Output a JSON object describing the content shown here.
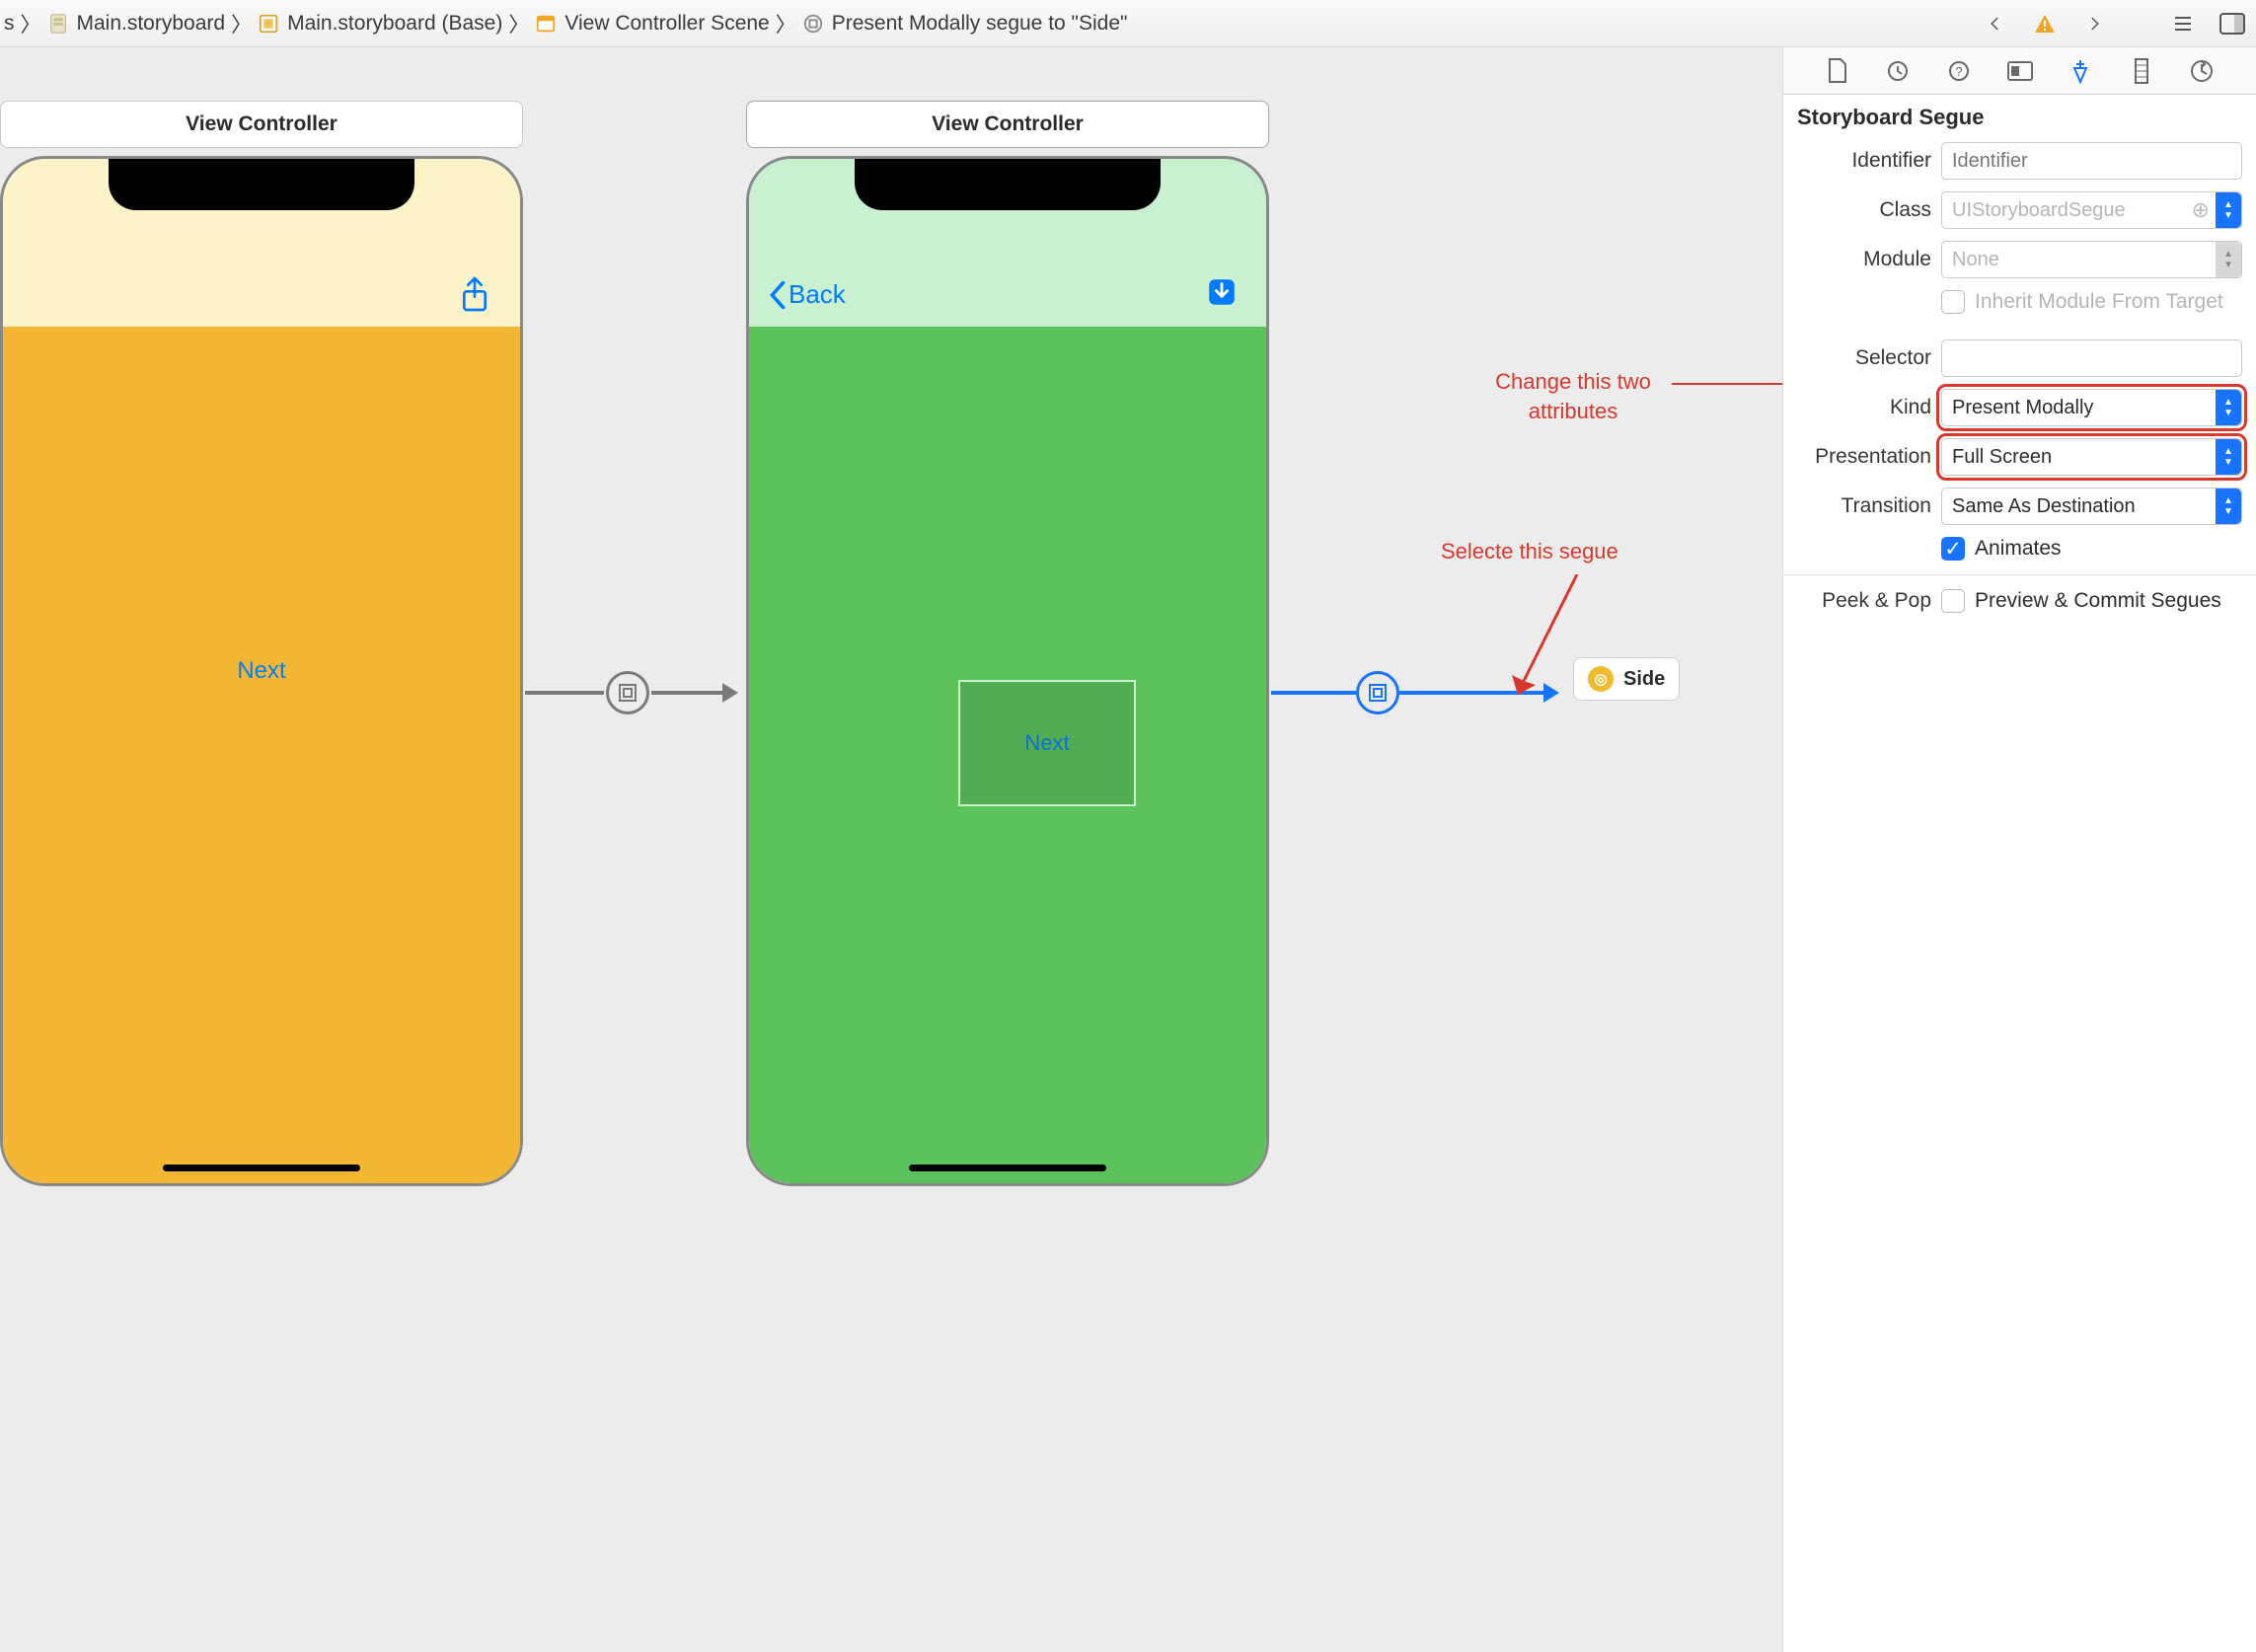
{
  "breadcrumbs": {
    "root_suffix": "s",
    "items": [
      {
        "label": "Main.storyboard"
      },
      {
        "label": "Main.storyboard (Base)"
      },
      {
        "label": "View Controller Scene"
      },
      {
        "label": "Present Modally segue to \"Side\""
      }
    ]
  },
  "canvas": {
    "scene1_title": "View Controller",
    "scene2_title": "View Controller",
    "scene1_button": "Next",
    "scene2_back": "Back",
    "scene2_container_label": "Next",
    "side_chip": "Side"
  },
  "annotations": {
    "change_attrs": "Change this two attributes",
    "select_segue": "Selecte this segue"
  },
  "inspector": {
    "section": "Storyboard Segue",
    "identifier_label": "Identifier",
    "identifier_placeholder": "Identifier",
    "class_label": "Class",
    "class_value": "UIStoryboardSegue",
    "module_label": "Module",
    "module_value": "None",
    "inherit_label": "Inherit Module From Target",
    "selector_label": "Selector",
    "kind_label": "Kind",
    "kind_value": "Present Modally",
    "presentation_label": "Presentation",
    "presentation_value": "Full Screen",
    "transition_label": "Transition",
    "transition_value": "Same As Destination",
    "animates_label": "Animates",
    "peek_label": "Peek & Pop",
    "peek_option": "Preview & Commit Segues"
  }
}
